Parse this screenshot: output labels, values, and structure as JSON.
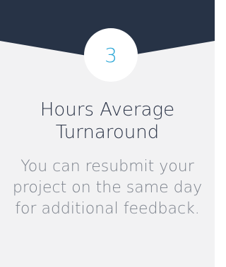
{
  "card": {
    "badge_number": "3",
    "title": "Hours Average Turnaround",
    "description": "You can resubmit your project on the same day for additional feedback."
  },
  "colors": {
    "header_band": "#273346",
    "badge_number": "#2aa6d6",
    "title": "#2a3346",
    "description": "#7b818b",
    "card_background": "#f2f2f3"
  }
}
